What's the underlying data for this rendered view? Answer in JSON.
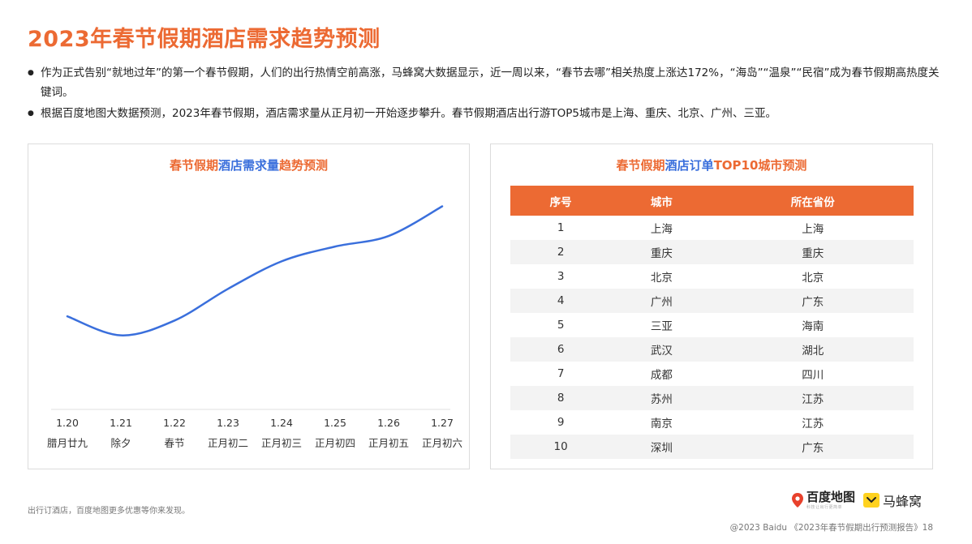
{
  "page": {
    "title": "2023年春节假期酒店需求趋势预测",
    "bullets": [
      "作为正式告别“就地过年”的第一个春节假期，人们的出行热情空前高涨，马蜂窝大数据显示，近一周以来，“春节去哪”相关热度上涨达172%，“海岛”“温泉”“民宿”成为春节假期高热度关键词。",
      "根据百度地图大数据预测，2023年春节假期，酒店需求量从正月初一开始逐步攀升。春节假期酒店出行游TOP5城市是上海、重庆、北京、广州、三亚。"
    ],
    "footnote": "出行订酒店，百度地图更多优惠等你来发现。",
    "copyright": "@2023 Baidu 《2023年春节假期出行预测报告》18",
    "logo_baidu": "百度地图",
    "logo_baidu_sub": "科技让出行更简单",
    "logo_mfw": "马蜂窝"
  },
  "chart_title": {
    "part1": "春节假期",
    "part2": "酒店需求量",
    "part3": "趋势预测"
  },
  "table_title": {
    "part1": "春节假期",
    "part2": "酒店订单",
    "part3": "TOP10城市预测"
  },
  "chart_data": [
    {
      "type": "line",
      "title": "春节假期酒店需求量趋势预测",
      "categories": [
        "1.20",
        "1.21",
        "1.22",
        "1.23",
        "1.24",
        "1.25",
        "1.26",
        "1.27"
      ],
      "subcategories": [
        "腊月廿九",
        "除夕",
        "春节",
        "正月初二",
        "正月初三",
        "正月初四",
        "正月初五",
        "正月初六"
      ],
      "values": [
        44,
        35,
        42,
        57,
        70,
        77,
        82,
        96
      ],
      "ylim": [
        0,
        110
      ],
      "line_color": "#3a6fdc",
      "grid": false,
      "y_axis_labels": false
    },
    {
      "type": "table",
      "title": "春节假期酒店订单TOP10城市预测",
      "columns": [
        "序号",
        "城市",
        "所在省份"
      ],
      "rows": [
        [
          "1",
          "上海",
          "上海"
        ],
        [
          "2",
          "重庆",
          "重庆"
        ],
        [
          "3",
          "北京",
          "北京"
        ],
        [
          "4",
          "广州",
          "广东"
        ],
        [
          "5",
          "三亚",
          "海南"
        ],
        [
          "6",
          "武汉",
          "湖北"
        ],
        [
          "7",
          "成都",
          "四川"
        ],
        [
          "8",
          "苏州",
          "江苏"
        ],
        [
          "9",
          "南京",
          "江苏"
        ],
        [
          "10",
          "深圳",
          "广东"
        ]
      ]
    }
  ],
  "colors": {
    "accent": "#ec6a33",
    "blue": "#3a6fdc",
    "row_alt": "#f3f3f3"
  }
}
